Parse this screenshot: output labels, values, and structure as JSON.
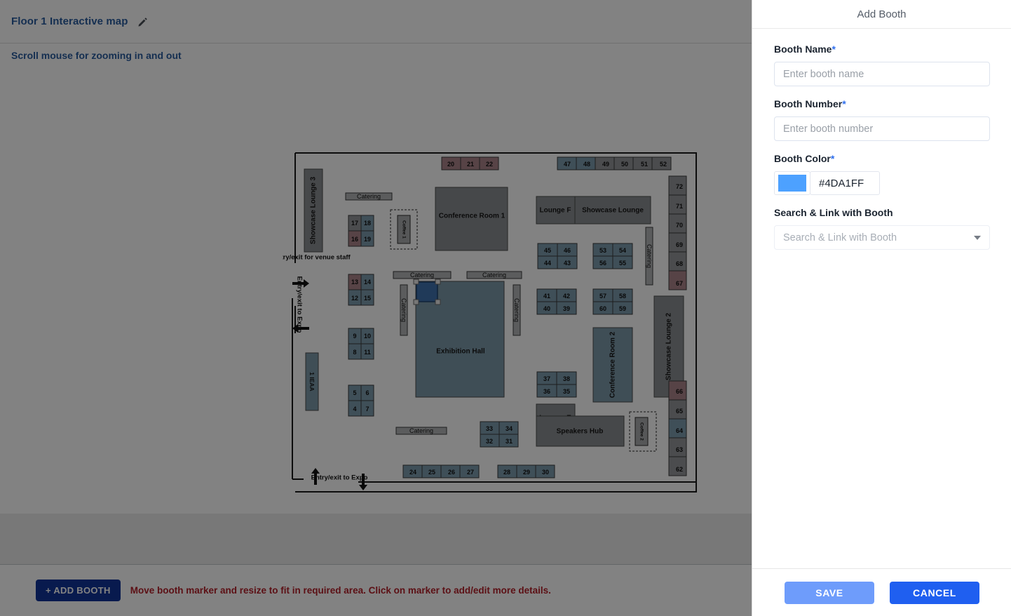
{
  "header": {
    "title": "Floor 1 Interactive map",
    "edit_icon": "pencil-icon",
    "subtitle": "Scroll mouse for zooming in and out"
  },
  "footer": {
    "add_booth_label": "+ ADD BOOTH",
    "hint": "Move booth marker and resize to fit in required area. Click on marker to add/edit more details.",
    "hint_color": "#b4202a",
    "add_booth_color": "#10349a"
  },
  "panel": {
    "title": "Add Booth",
    "booth_name": {
      "label": "Booth Name",
      "required": "*",
      "value": "",
      "placeholder": "Enter booth name"
    },
    "booth_number": {
      "label": "Booth Number",
      "required": "*",
      "value": "",
      "placeholder": "Enter booth number"
    },
    "booth_color": {
      "label": "Booth Color",
      "required": "*",
      "hex": "#4DA1FF",
      "swatch": "#4DA1FF"
    },
    "search_link": {
      "label": "Search & Link with Booth",
      "value": "",
      "placeholder": "Search & Link with Booth",
      "caret_icon": "chevron-down-icon"
    },
    "save_label": "SAVE",
    "cancel_label": "CANCEL",
    "save_color": "#6e9cfb",
    "cancel_color": "#1f5ff0"
  },
  "map": {
    "rooms": [
      {
        "name": "Showcase Lounge 3",
        "rotated": true
      },
      {
        "name": "Conference Room 1",
        "rotated": false
      },
      {
        "name": "Lounge F",
        "rotated": false
      },
      {
        "name": "Showcase Lounge",
        "rotated": false
      },
      {
        "name": "Showcase Lounge 2",
        "rotated": true
      },
      {
        "name": "Lounge E",
        "rotated": false
      },
      {
        "name": "Conference Room 2",
        "rotated": true
      },
      {
        "name": "Speakers Hub",
        "rotated": false
      },
      {
        "name": "Exhibition Hall",
        "rotated": false
      },
      {
        "name": "1 IEAA",
        "rotated": true
      }
    ],
    "catering_labels": [
      "Catering",
      "Catering",
      "Catering",
      "Catering",
      "Catering",
      "Catering",
      "Catering"
    ],
    "coffee_labels": [
      "Coffee 1",
      "Coffee 2"
    ],
    "annotations": [
      "Entry/exit for venue staff",
      "Entry/exit to Expo",
      "Entry/exit to Expo"
    ],
    "colors": {
      "blue_booth": "#7d9cad",
      "pink_booth": "#ab8389",
      "white_booth": "#93969a",
      "room_fill": "#8a8d91",
      "hall_fill": "#7d99aa",
      "marker": "#3f72ae",
      "marker_stroke": "#21456e"
    },
    "booths": [
      {
        "n": "20",
        "c": "pink"
      },
      {
        "n": "21",
        "c": "pink"
      },
      {
        "n": "22",
        "c": "pink"
      },
      {
        "n": "47",
        "c": "blue"
      },
      {
        "n": "48",
        "c": "blue"
      },
      {
        "n": "49",
        "c": "white"
      },
      {
        "n": "50",
        "c": "white"
      },
      {
        "n": "51",
        "c": "white"
      },
      {
        "n": "52",
        "c": "white"
      },
      {
        "n": "72",
        "c": "white"
      },
      {
        "n": "71",
        "c": "white"
      },
      {
        "n": "70",
        "c": "white"
      },
      {
        "n": "69",
        "c": "white"
      },
      {
        "n": "68",
        "c": "white"
      },
      {
        "n": "67",
        "c": "pink"
      },
      {
        "n": "17",
        "c": "white"
      },
      {
        "n": "18",
        "c": "blue"
      },
      {
        "n": "16",
        "c": "pink"
      },
      {
        "n": "19",
        "c": "blue"
      },
      {
        "n": "45",
        "c": "blue"
      },
      {
        "n": "46",
        "c": "blue"
      },
      {
        "n": "44",
        "c": "blue"
      },
      {
        "n": "43",
        "c": "blue"
      },
      {
        "n": "53",
        "c": "blue"
      },
      {
        "n": "54",
        "c": "blue"
      },
      {
        "n": "56",
        "c": "blue"
      },
      {
        "n": "55",
        "c": "blue"
      },
      {
        "n": "13",
        "c": "pink"
      },
      {
        "n": "14",
        "c": "blue"
      },
      {
        "n": "12",
        "c": "blue"
      },
      {
        "n": "15",
        "c": "blue"
      },
      {
        "n": "41",
        "c": "blue"
      },
      {
        "n": "42",
        "c": "blue"
      },
      {
        "n": "40",
        "c": "blue"
      },
      {
        "n": "39",
        "c": "blue"
      },
      {
        "n": "57",
        "c": "blue"
      },
      {
        "n": "58",
        "c": "blue"
      },
      {
        "n": "60",
        "c": "blue"
      },
      {
        "n": "59",
        "c": "blue"
      },
      {
        "n": "9",
        "c": "blue"
      },
      {
        "n": "10",
        "c": "blue"
      },
      {
        "n": "8",
        "c": "blue"
      },
      {
        "n": "11",
        "c": "blue"
      },
      {
        "n": "37",
        "c": "blue"
      },
      {
        "n": "38",
        "c": "blue"
      },
      {
        "n": "36",
        "c": "blue"
      },
      {
        "n": "35",
        "c": "blue"
      },
      {
        "n": "66",
        "c": "pink"
      },
      {
        "n": "65",
        "c": "white"
      },
      {
        "n": "64",
        "c": "blue"
      },
      {
        "n": "63",
        "c": "white"
      },
      {
        "n": "62",
        "c": "white"
      },
      {
        "n": "5",
        "c": "blue"
      },
      {
        "n": "6",
        "c": "blue"
      },
      {
        "n": "4",
        "c": "blue"
      },
      {
        "n": "7",
        "c": "blue"
      },
      {
        "n": "33",
        "c": "blue"
      },
      {
        "n": "34",
        "c": "blue"
      },
      {
        "n": "32",
        "c": "blue"
      },
      {
        "n": "31",
        "c": "blue"
      },
      {
        "n": "24",
        "c": "blue"
      },
      {
        "n": "25",
        "c": "blue"
      },
      {
        "n": "26",
        "c": "blue"
      },
      {
        "n": "27",
        "c": "blue"
      },
      {
        "n": "28",
        "c": "blue"
      },
      {
        "n": "29",
        "c": "blue"
      },
      {
        "n": "30",
        "c": "blue"
      }
    ]
  }
}
